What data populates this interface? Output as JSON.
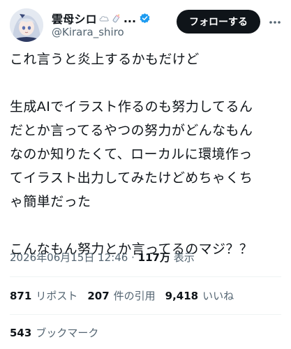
{
  "user": {
    "display_name": "雲母シロ",
    "ellipsis": "...",
    "handle": "@Kirara_shiro",
    "emoji_icons": [
      "cloud-icon",
      "baby-bottle-icon"
    ],
    "verified_icon": "verified-badge-icon",
    "avatar_icon": "avatar-icon"
  },
  "actions": {
    "follow_label": "フォローする",
    "more_icon": "more-icon"
  },
  "tweet": {
    "lines": [
      "これ言うと炎上するかもだけど",
      "生成AIでイラスト作るのも努力してるん",
      "だとか言ってるやつの努力がどんなもん",
      "なのか知りたくて、ローカルに環境作っ",
      "てイラスト出力してみたけどめちゃくち",
      "ゃ簡単だった",
      "こんなもん努力とか言ってるのマジ？？"
    ]
  },
  "meta": {
    "datetime": "2026年06月15日 12:46 · ",
    "views": "117万",
    "views_label": " 表示"
  },
  "stats": {
    "reposts": "871",
    "reposts_label": "リポスト",
    "quotes": "207",
    "quotes_label": "件の引用",
    "likes": "9,418",
    "likes_label": "いいね",
    "bookmarks": "543",
    "bookmarks_label": "ブックマーク"
  },
  "colors": {
    "text": "#0f1419",
    "secondary": "#536471",
    "verified": "#1d9bf0",
    "follow_bg": "#0f1419",
    "divider": "#eff3f4"
  }
}
